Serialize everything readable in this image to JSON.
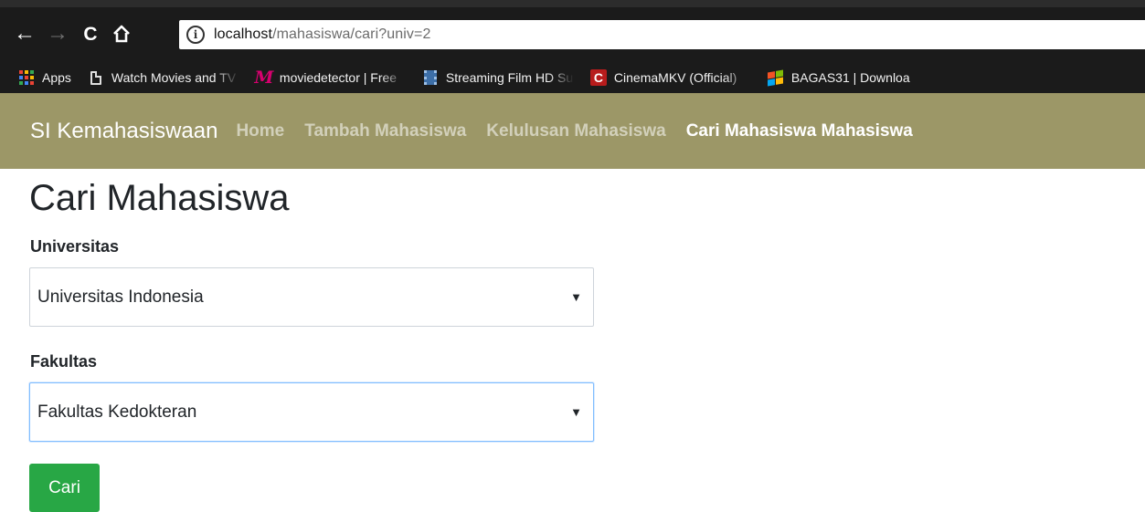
{
  "browser": {
    "url_host": "localhost",
    "url_path": "/mahasiswa/cari?univ=2",
    "bookmarks": [
      {
        "label": "Apps",
        "icon": "apps-grid-icon"
      },
      {
        "label": "Watch Movies and TV",
        "icon": "document-icon"
      },
      {
        "label": "moviedetector | Free",
        "icon": "moviedetector-m-icon"
      },
      {
        "label": "Streaming Film HD Su",
        "icon": "film-strip-icon"
      },
      {
        "label": "CinemaMKV (Official)",
        "icon": "cinemamkv-c-icon"
      },
      {
        "label": "BAGAS31 | Downloa",
        "icon": "windows-logo-icon"
      }
    ]
  },
  "navbar": {
    "brand": "SI Kemahasiswaan",
    "links": [
      {
        "label": "Home",
        "active": false
      },
      {
        "label": "Tambah Mahasiswa",
        "active": false
      },
      {
        "label": "Kelulusan Mahasiswa",
        "active": false
      },
      {
        "label": "Cari Mahasiswa Mahasiswa",
        "active": true
      }
    ],
    "background": "#9c9767"
  },
  "main": {
    "title": "Cari Mahasiswa",
    "universitas": {
      "label": "Universitas",
      "selected": "Universitas Indonesia"
    },
    "fakultas": {
      "label": "Fakultas",
      "selected": "Fakultas Kedokteran"
    },
    "submit_label": "Cari",
    "submit_color": "#28a745"
  }
}
